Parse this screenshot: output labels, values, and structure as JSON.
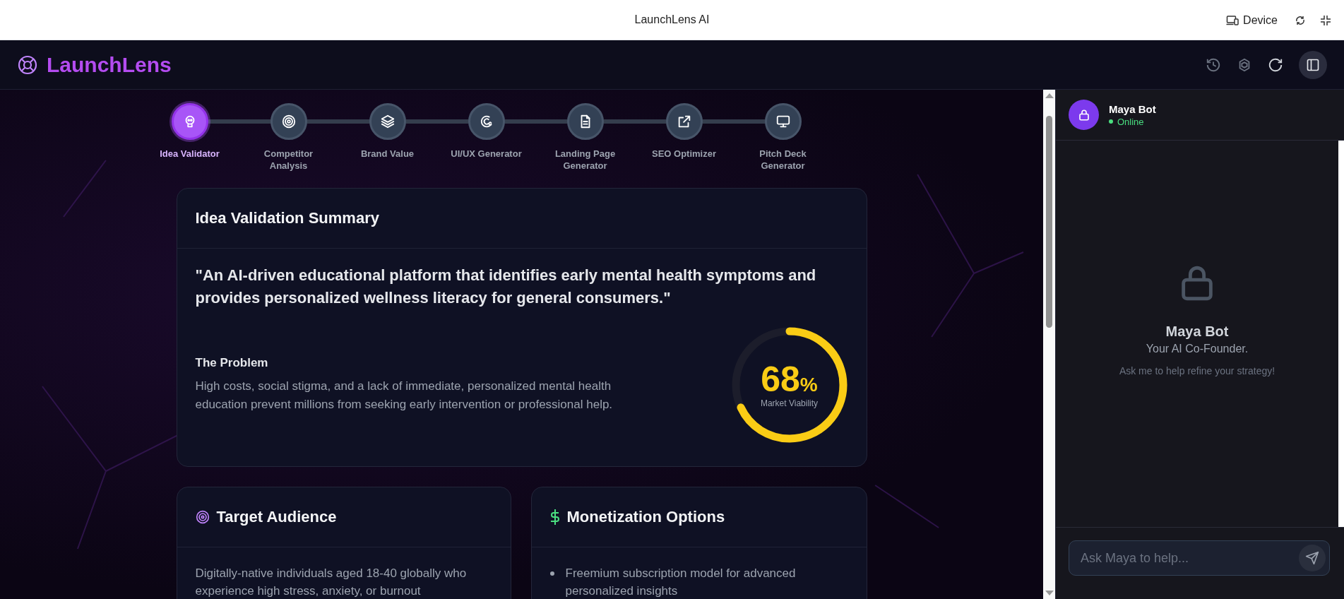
{
  "browser_bar": {
    "title": "LaunchLens AI",
    "device_label": "Device"
  },
  "app_header": {
    "logo": "LaunchLens",
    "sidebar_open": true
  },
  "steps": [
    {
      "label": "Idea Validator",
      "kind": "bot",
      "selected": true
    },
    {
      "label": "Competitor Analysis",
      "kind": "target",
      "selected": false
    },
    {
      "label": "Brand Value",
      "kind": "layers",
      "selected": false
    },
    {
      "label": "UI/UX Generator",
      "kind": "swirl",
      "selected": false
    },
    {
      "label": "Landing Page Generator",
      "kind": "document",
      "selected": false
    },
    {
      "label": "SEO Optimizer",
      "kind": "external",
      "selected": false
    },
    {
      "label": "Pitch Deck Generator",
      "kind": "monitor",
      "selected": false
    }
  ],
  "summary": {
    "title": "Idea Validation Summary",
    "quote": "\"An AI-driven educational platform that identifies early mental health symptoms and provides personalized wellness literacy for general consumers.\"",
    "problem_heading": "The Problem",
    "problem_text": "High costs, social stigma, and a lack of immediate, personalized mental health education prevent millions from seeking early intervention or professional help.",
    "viability": {
      "level": 0.68,
      "value": "68",
      "unit": "%",
      "label": "Market Viability"
    }
  },
  "target_audience": {
    "title": "Target Audience",
    "text": "Digitally-native individuals aged 18-40 globally who experience high stress, anxiety, or burnout"
  },
  "monetization": {
    "title": "Monetization Options",
    "items": [
      "Freemium subscription model for advanced personalized insights"
    ]
  },
  "chat": {
    "name": "Maya Bot",
    "status": "Online",
    "online": true,
    "empty_title": "Maya Bot",
    "empty_subtitle": "Your AI Co-Founder.",
    "empty_hint": "Ask me to help refine your strategy!",
    "input_placeholder": "Ask Maya to help..."
  }
}
